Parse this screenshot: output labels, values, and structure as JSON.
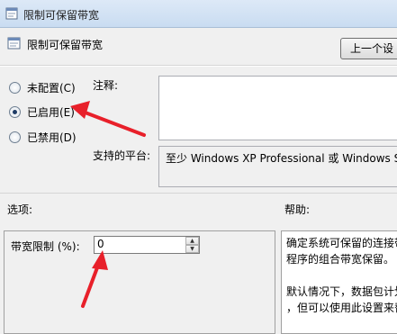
{
  "window": {
    "title": "限制可保留带宽",
    "icon": "policy-window-icon"
  },
  "header": {
    "title": "限制可保留带宽",
    "prev_button": "上一个设",
    "icon": "policy-setting-icon"
  },
  "state": {
    "options": [
      {
        "label": "未配置(C)",
        "checked": false
      },
      {
        "label": "已启用(E)",
        "checked": true
      },
      {
        "label": "已禁用(D)",
        "checked": false
      }
    ]
  },
  "comment": {
    "label": "注释:",
    "value": ""
  },
  "platform": {
    "label": "支持的平台:",
    "value": "至少 Windows XP Professional 或 Windows S"
  },
  "options_section": {
    "label": "选项:",
    "bandwidth_label": "带宽限制 (%):",
    "bandwidth_value": "0"
  },
  "help_section": {
    "label": "帮助:",
    "lines": [
      "确定系统可保留的连接带",
      "程序的组合带宽保留。",
      "",
      "默认情况下，数据包计划",
      "，但可以使用此设置来替"
    ]
  },
  "colors": {
    "annotation": "#e8202a",
    "titlebar": "#c9dcf1"
  }
}
